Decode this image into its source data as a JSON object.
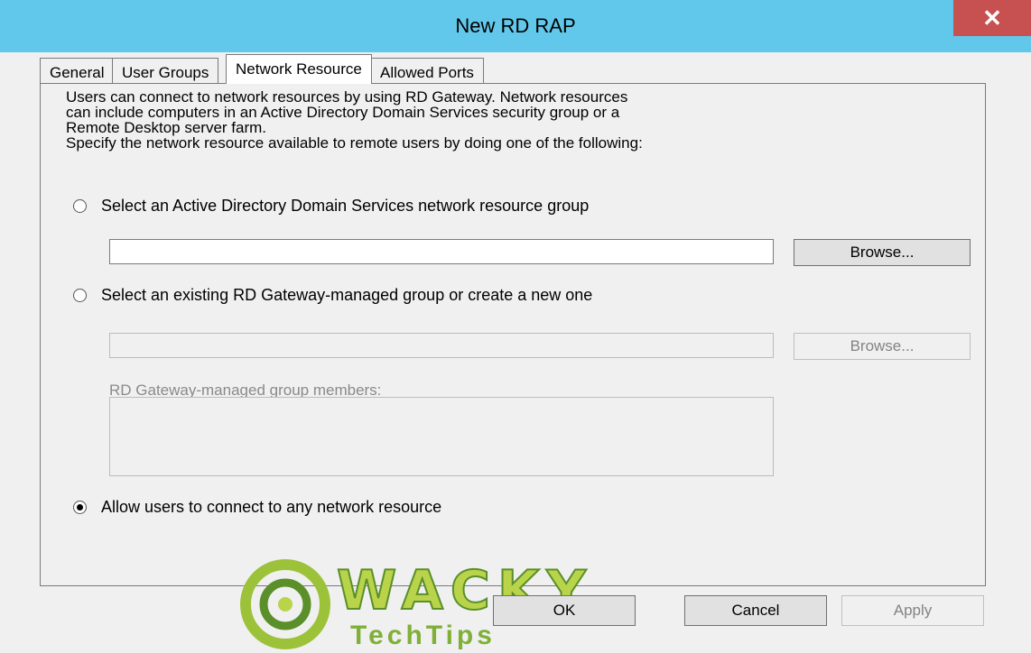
{
  "window": {
    "title": "New RD RAP",
    "close_glyph": "✕"
  },
  "tabs": [
    {
      "label": "General",
      "active": false
    },
    {
      "label": "User Groups",
      "active": false
    },
    {
      "label": "Network Resource",
      "active": true
    },
    {
      "label": "Allowed Ports",
      "active": false
    }
  ],
  "panel": {
    "intro_lines": [
      "Users can connect to network resources by using RD Gateway. Network resources",
      "can include computers in an Active Directory Domain Services security group or a",
      "Remote Desktop server farm.",
      "Specify the network resource available to remote users by doing one of the following:"
    ],
    "options": {
      "ad_group": {
        "label": "Select an Active Directory Domain Services network resource group",
        "checked": false,
        "value": "",
        "browse_label": "Browse...",
        "enabled": true
      },
      "gateway_group": {
        "label": "Select an existing RD Gateway-managed group or create a new one",
        "checked": false,
        "value": "",
        "browse_label": "Browse...",
        "enabled": false,
        "members_label": "RD Gateway-managed group members:"
      },
      "any_resource": {
        "label": "Allow users to connect to any network resource",
        "checked": true
      }
    }
  },
  "footer": {
    "ok_label": "OK",
    "cancel_label": "Cancel",
    "apply_label": "Apply",
    "apply_enabled": false
  },
  "watermark": {
    "logo_text": "WACKY",
    "sub_text": "TechTips"
  },
  "colors": {
    "titlebar": "#62c8eb",
    "close": "#c75050",
    "watermark": "#b9d44a"
  }
}
